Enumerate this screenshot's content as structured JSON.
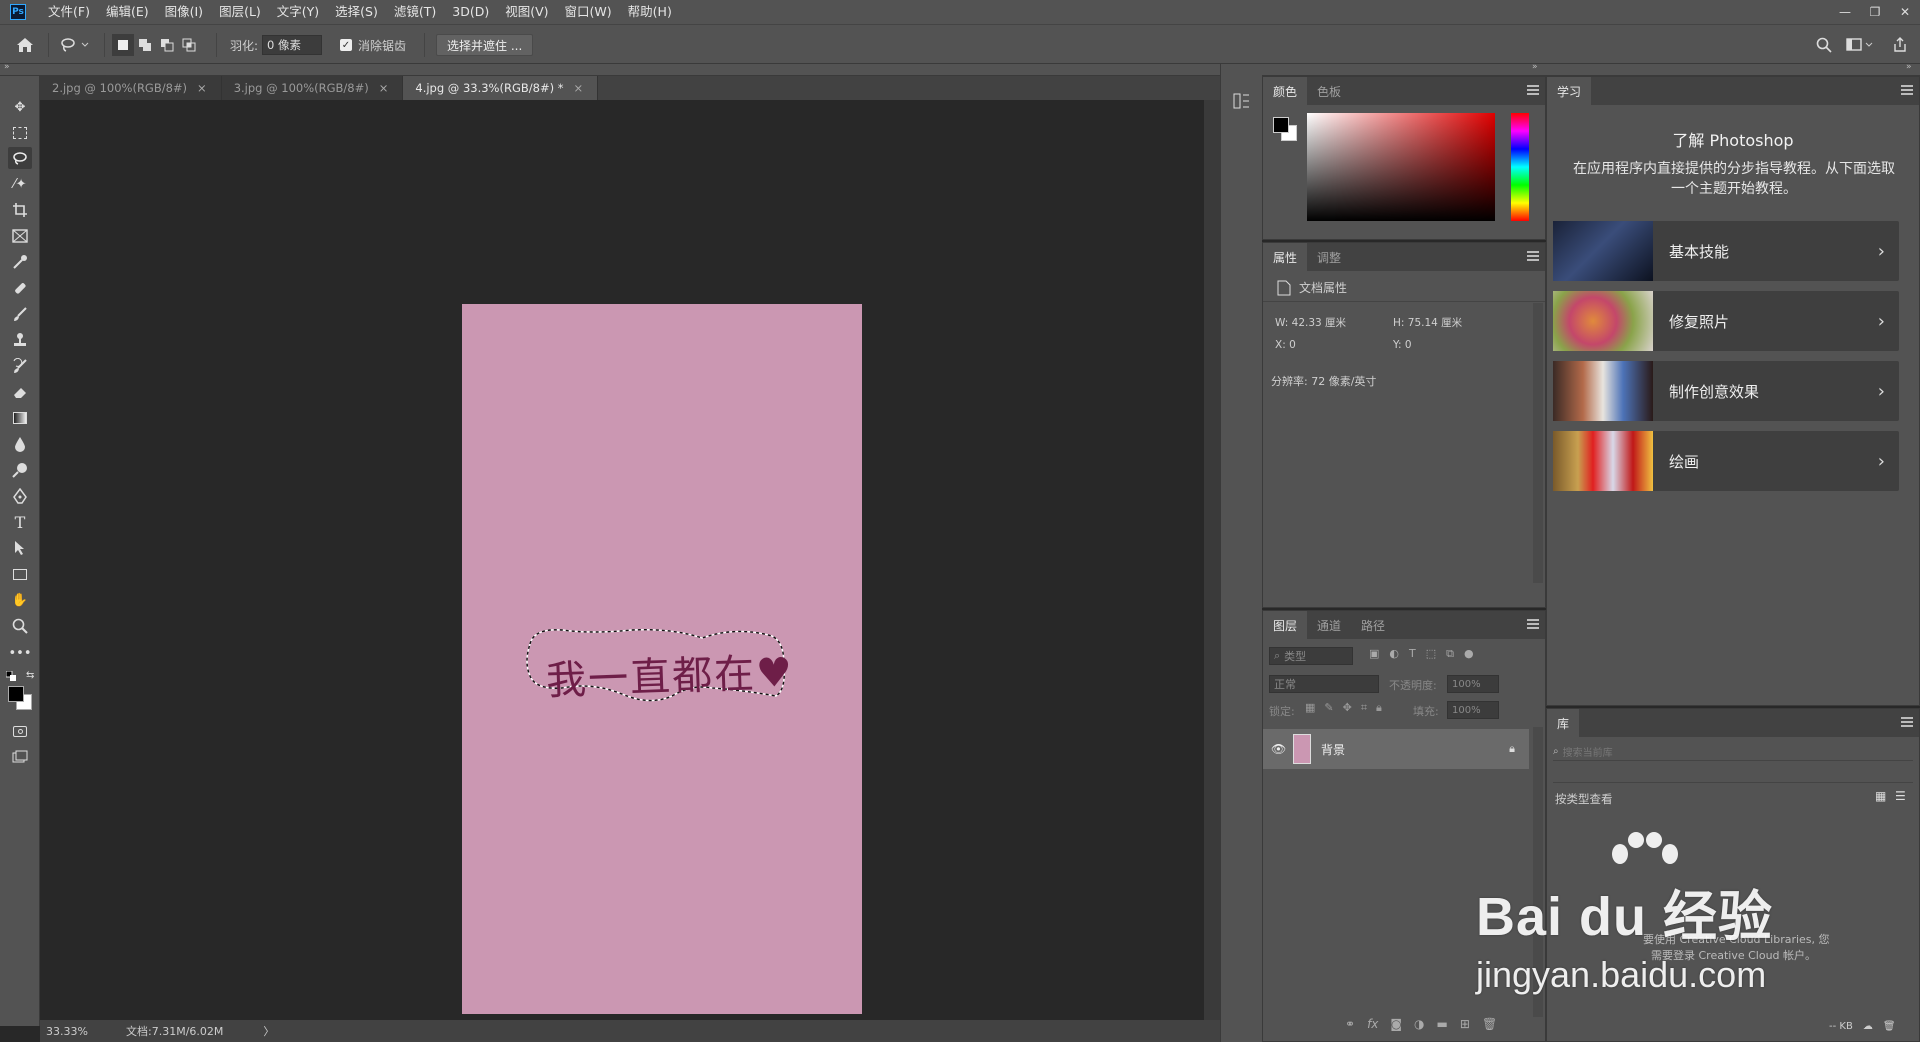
{
  "app": {
    "logo": "Ps"
  },
  "menu": [
    "文件(F)",
    "编辑(E)",
    "图像(I)",
    "图层(L)",
    "文字(Y)",
    "选择(S)",
    "滤镜(T)",
    "3D(D)",
    "视图(V)",
    "窗口(W)",
    "帮助(H)"
  ],
  "options": {
    "feather_label": "羽化:",
    "feather_value": "0 像素",
    "antialias_label": "消除锯齿",
    "select_mask_label": "选择并遮住 ..."
  },
  "tabs": [
    {
      "label": "2.jpg @ 100%(RGB/8#)"
    },
    {
      "label": "3.jpg @ 100%(RGB/8#)"
    },
    {
      "label": "4.jpg @ 33.3%(RGB/8#) *"
    }
  ],
  "canvas": {
    "doc_color": "#cb97b2",
    "handwriting": "我一直都在♥"
  },
  "status": {
    "zoom": "33.33%",
    "doc": "文档:7.31M/6.02M",
    "arrow": "〉"
  },
  "color_panel": {
    "tabs": [
      "颜色",
      "色板"
    ]
  },
  "properties_panel": {
    "tabs": [
      "属性",
      "调整"
    ],
    "doc_props": "文档属性",
    "w": "W:  42.33  厘米",
    "h": "H:  75.14  厘米",
    "x": "X:  0",
    "y": "Y:  0",
    "resolution": "分辨率: 72 像素/英寸"
  },
  "layers_panel": {
    "tabs": [
      "图层",
      "通道",
      "路径"
    ],
    "filter_label": "类型",
    "blend_mode": "正常",
    "opacity_label": "不透明度:",
    "opacity_value": "100%",
    "lock_label": "锁定:",
    "fill_label": "填充:",
    "fill_value": "100%",
    "layer_name": "背景"
  },
  "learn_panel": {
    "tab": "学习",
    "title": "了解 Photoshop",
    "desc": "在应用程序内直接提供的分步指导教程。从下面选取一个主题开始教程。",
    "cards": [
      {
        "label": "基本技能"
      },
      {
        "label": "修复照片"
      },
      {
        "label": "制作创意效果"
      },
      {
        "label": "绘画"
      }
    ]
  },
  "library_panel": {
    "tab": "库",
    "search_placeholder": "搜索当前库",
    "view_by": "按类型查看",
    "msg_line1": "要使用 Creative Cloud Libraries, 您",
    "msg_line2": "需要登录 Creative Cloud 帐户。",
    "kb": "-- KB"
  },
  "watermark": {
    "brand": "Bai du 经验",
    "url": "jingyan.baidu.com"
  }
}
